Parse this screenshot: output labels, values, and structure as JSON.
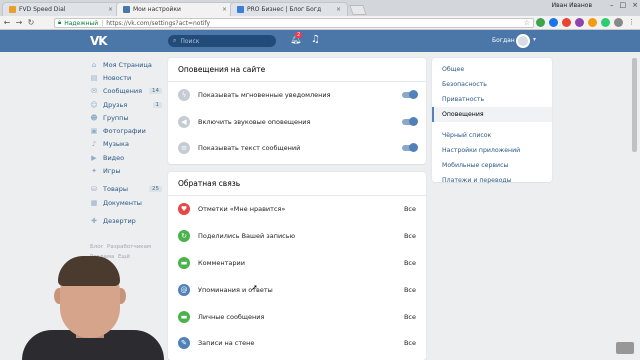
{
  "browser": {
    "tabs": [
      {
        "title": "FVD Speed Dial",
        "favicon_color": "#e8a02a",
        "active": false
      },
      {
        "title": "Мои настройки",
        "favicon_color": "#4a76a8",
        "active": true
      },
      {
        "title": "PRO Бизнес | Блог Богд",
        "favicon_color": "#3b7dd8",
        "active": false
      }
    ],
    "window_user": "Иван Иванов",
    "address": {
      "secure_label": "Надежный",
      "url": "https://vk.com/settings?act=notify"
    }
  },
  "header": {
    "search_placeholder": "Поиск",
    "notifications_count": "2",
    "user_name": "Богдан"
  },
  "left_menu": {
    "items": [
      {
        "label": "Моя Страница",
        "icon": "home-icon",
        "badge": ""
      },
      {
        "label": "Новости",
        "icon": "news-icon",
        "badge": ""
      },
      {
        "label": "Сообщения",
        "icon": "messages-icon",
        "badge": "14"
      },
      {
        "label": "Друзья",
        "icon": "friends-icon",
        "badge": "1"
      },
      {
        "label": "Группы",
        "icon": "groups-icon",
        "badge": ""
      },
      {
        "label": "Фотографии",
        "icon": "photos-icon",
        "badge": ""
      },
      {
        "label": "Музыка",
        "icon": "music-icon",
        "badge": ""
      },
      {
        "label": "Видео",
        "icon": "video-icon",
        "badge": ""
      },
      {
        "label": "Игры",
        "icon": "games-icon",
        "badge": ""
      }
    ],
    "items2": [
      {
        "label": "Товары",
        "icon": "goods-icon",
        "badge": "25"
      },
      {
        "label": "Документы",
        "icon": "docs-icon",
        "badge": ""
      }
    ],
    "items3": [
      {
        "label": "Дезертир",
        "icon": "app-icon",
        "badge": ""
      }
    ],
    "footer": {
      "blog": "Блог",
      "dev": "Разработчикам",
      "ads": "Реклама",
      "more": "Ещё"
    }
  },
  "site_notifications": {
    "title": "Оповещения на сайте",
    "rows": [
      {
        "label": "Показывать мгновенные уведомления",
        "enabled": true
      },
      {
        "label": "Включить звуковые оповещения",
        "enabled": true
      },
      {
        "label": "Показывать текст сообщений",
        "enabled": true
      }
    ]
  },
  "feedback": {
    "title": "Обратная связь",
    "rows": [
      {
        "label": "Отметки «Мне нравится»",
        "value": "Все",
        "color": "#e64646",
        "icon": "heart-icon"
      },
      {
        "label": "Поделились Вашей записью",
        "value": "Все",
        "color": "#4bb34b",
        "icon": "share-icon"
      },
      {
        "label": "Комментарии",
        "value": "Все",
        "color": "#4bb34b",
        "icon": "comment-icon"
      },
      {
        "label": "Упоминания и ответы",
        "value": "Все",
        "color": "#5181b8",
        "icon": "mention-icon"
      },
      {
        "label": "Личные сообщения",
        "value": "Все",
        "color": "#4bb34b",
        "icon": "message-icon"
      },
      {
        "label": "Записи на стене",
        "value": "Все",
        "color": "#5181b8",
        "icon": "wall-icon"
      }
    ]
  },
  "settings_nav": {
    "items": [
      "Общее",
      "Безопасность",
      "Приватность",
      "Оповещения",
      "Чёрный список",
      "Настройки приложений",
      "Мобильные сервисы",
      "Платежи и переводы"
    ],
    "active_index": 3
  },
  "colors": {
    "vk_blue": "#4a76a8",
    "link": "#2a5885",
    "toggle": "#5181b8"
  }
}
